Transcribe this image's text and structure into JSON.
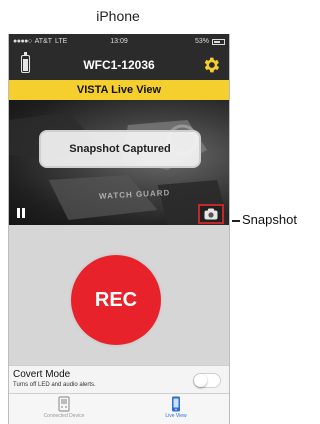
{
  "caption": "iPhone",
  "status_bar": {
    "carrier": "AT&T",
    "network": "LTE",
    "time": "13:09",
    "battery": "53%"
  },
  "nav": {
    "title": "WFC1-12036",
    "left_icon": "phone-battery-icon",
    "right_icon": "gear-icon"
  },
  "banner": {
    "label": "VISTA Live View",
    "color": "#f5cf2e"
  },
  "video": {
    "toast": "Snapshot Captured",
    "watermark": "WATCH GUARD"
  },
  "record": {
    "label": "REC",
    "color": "#e8222b"
  },
  "covert": {
    "title": "Covert Mode",
    "description": "Turns off LED and audio alerts.",
    "enabled": false
  },
  "tabs": [
    {
      "label": "Connected Device",
      "icon": "device-icon",
      "active": false
    },
    {
      "label": "Live View",
      "icon": "phone-icon",
      "active": true
    }
  ],
  "callout": {
    "label": "Snapshot",
    "highlight_color": "#c0282c"
  }
}
